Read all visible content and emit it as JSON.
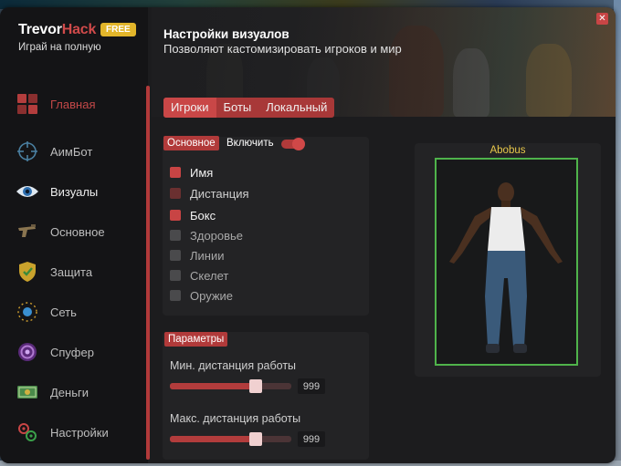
{
  "brand": {
    "name_part1": "Trevor",
    "name_part2": "Hack",
    "badge": "FREE",
    "tagline": "Играй на полную"
  },
  "sidebar": {
    "items": [
      {
        "label": "Главная",
        "icon": "home-grid-icon",
        "state": "active"
      },
      {
        "label": "АимБот",
        "icon": "crosshair-icon",
        "state": "normal"
      },
      {
        "label": "Визуалы",
        "icon": "eye-icon",
        "state": "bright"
      },
      {
        "label": "Основное",
        "icon": "gun-icon",
        "state": "normal"
      },
      {
        "label": "Защита",
        "icon": "shield-icon",
        "state": "normal"
      },
      {
        "label": "Сеть",
        "icon": "network-icon",
        "state": "normal"
      },
      {
        "label": "Спуфер",
        "icon": "spoofer-icon",
        "state": "normal"
      },
      {
        "label": "Деньги",
        "icon": "money-icon",
        "state": "normal"
      },
      {
        "label": "Настройки",
        "icon": "settings-icon",
        "state": "normal"
      }
    ]
  },
  "header": {
    "title": "Настройки визуалов",
    "subtitle": "Позволяют кастомизировать игроков и мир"
  },
  "tabs": [
    {
      "label": "Игроки",
      "active": true
    },
    {
      "label": "Боты",
      "active": false
    },
    {
      "label": "Локальный",
      "active": false
    }
  ],
  "main_panel": {
    "tag": "Основное",
    "toggle_label": "Включить",
    "toggle_on": true,
    "options": [
      {
        "label": "Имя",
        "state": "on"
      },
      {
        "label": "Дистанция",
        "state": "mid"
      },
      {
        "label": "Бокс",
        "state": "on"
      },
      {
        "label": "Здоровье",
        "state": "off"
      },
      {
        "label": "Линии",
        "state": "off"
      },
      {
        "label": "Скелет",
        "state": "off"
      },
      {
        "label": "Оружие",
        "state": "off"
      }
    ]
  },
  "params_panel": {
    "tag": "Параметры",
    "sliders": [
      {
        "label": "Мин. дистанция работы",
        "value": "999",
        "fraction": 0.71
      },
      {
        "label": "Макс. дистанция работы",
        "value": "999",
        "fraction": 0.71
      }
    ]
  },
  "preview": {
    "player_name": "Abobus",
    "box_color": "#4fb34b"
  },
  "colors": {
    "accent": "#c84545",
    "badge": "#e2b52a",
    "name_tag": "#e8c84a"
  }
}
